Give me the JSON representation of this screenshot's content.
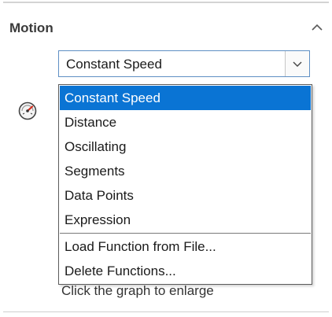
{
  "panel": {
    "title": "Motion",
    "collapse_icon": "chevron-up-icon",
    "motion_icon": "speedometer-icon"
  },
  "combo": {
    "selected": "Constant Speed",
    "dropdown_icon": "chevron-down-icon"
  },
  "dropdown": {
    "options": [
      "Constant Speed",
      "Distance",
      "Oscillating",
      "Segments",
      "Data Points",
      "Expression"
    ],
    "highlighted_option": "Constant Speed",
    "actions": [
      "Load Function from File...",
      "Delete Functions..."
    ]
  },
  "hint_text": "Click the graph to enlarge",
  "colors": {
    "selection": "#0a74d4",
    "combo_border": "#5f8fc4"
  }
}
